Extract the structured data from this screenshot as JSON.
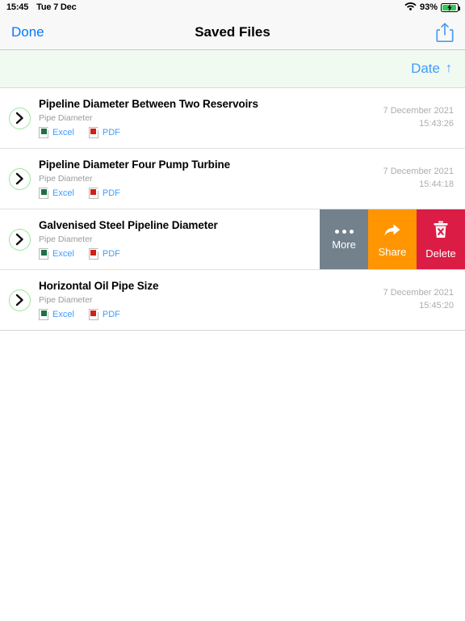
{
  "status_bar": {
    "time": "15:45",
    "date": "Tue 7 Dec",
    "wifi_icon": "wifi-icon",
    "battery_percent": "93%",
    "battery_icon": "battery-charging-icon"
  },
  "nav_bar": {
    "done_label": "Done",
    "title": "Saved Files",
    "share_icon": "share-icon"
  },
  "sort_bar": {
    "sort_label": "Date",
    "sort_direction_icon": "arrow-up-icon",
    "sort_direction_glyph": "↑",
    "background_color": "#f0faf0"
  },
  "list": {
    "items": [
      {
        "title": "Pipeline Diameter Between Two Reservoirs",
        "subtitle": "Pipe Diameter",
        "files": [
          {
            "label": "Excel",
            "icon": "excel-file-icon",
            "color": "#1d7044"
          },
          {
            "label": "PDF",
            "icon": "pdf-file-icon",
            "color": "#d0201a"
          }
        ],
        "date": "7 December 2021",
        "time": "15:43:26",
        "disclosure_icon": "chevron-right-icon",
        "swiped": false
      },
      {
        "title": "Pipeline Diameter Four Pump Turbine",
        "subtitle": "Pipe Diameter",
        "files": [
          {
            "label": "Excel",
            "icon": "excel-file-icon",
            "color": "#1d7044"
          },
          {
            "label": "PDF",
            "icon": "pdf-file-icon",
            "color": "#d0201a"
          }
        ],
        "date": "7 December 2021",
        "time": "15:44:18",
        "disclosure_icon": "chevron-right-icon",
        "swiped": false
      },
      {
        "title": "Galvenised Steel Pipeline Diameter",
        "subtitle": "Pipe Diameter",
        "files": [
          {
            "label": "Excel",
            "icon": "excel-file-icon",
            "color": "#1d7044"
          },
          {
            "label": "PDF",
            "icon": "pdf-file-icon",
            "color": "#d0201a"
          }
        ],
        "date": "",
        "time": "",
        "disclosure_icon": "chevron-right-icon",
        "swiped": true
      },
      {
        "title": "Horizontal Oil Pipe Size",
        "subtitle": "Pipe Diameter",
        "files": [
          {
            "label": "Excel",
            "icon": "excel-file-icon",
            "color": "#1d7044"
          },
          {
            "label": "PDF",
            "icon": "pdf-file-icon",
            "color": "#d0201a"
          }
        ],
        "date": "7 December 2021",
        "time": "15:45:20",
        "disclosure_icon": "chevron-right-icon",
        "swiped": false
      }
    ]
  },
  "swipe_actions": {
    "more": {
      "label": "More",
      "icon": "ellipsis-icon",
      "color": "#73818c"
    },
    "share": {
      "label": "Share",
      "icon": "share-arrow-icon",
      "color": "#ff9500"
    },
    "delete": {
      "label": "Delete",
      "icon": "trash-icon",
      "color": "#db1c45"
    }
  },
  "colors": {
    "accent_blue": "#007aff",
    "link_blue": "#3f9bff",
    "chevron_green": "#9ae79a",
    "nav_background": "#f8f8f8"
  }
}
